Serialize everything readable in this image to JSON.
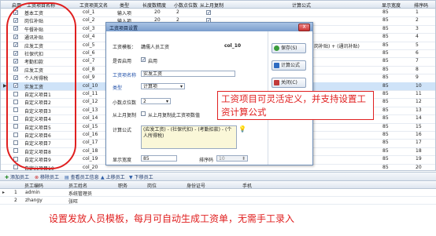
{
  "grid": {
    "headers": [
      "启用",
      "工资项目名称",
      "工资项英文名",
      "类型",
      "长度数精度",
      "小数点位数",
      "从上月复制",
      "计算公式",
      "显示宽度",
      "排序码"
    ],
    "rows": [
      {
        "enabled": "✓",
        "name": "基本工资",
        "en": "col_1",
        "type": "输入项",
        "len": "20",
        "dec": "2",
        "copy": "✓",
        "formula": "",
        "width": "85",
        "order": "1"
      },
      {
        "enabled": "✓",
        "name": "岗位补贴",
        "en": "col_2",
        "type": "输入项",
        "len": "20",
        "dec": "2",
        "copy": "✓",
        "formula": "",
        "width": "85",
        "order": "2"
      },
      {
        "enabled": "✓",
        "name": "午餐补贴",
        "en": "col_3",
        "type": "输入项",
        "len": "",
        "dec": "",
        "copy": "",
        "formula": "",
        "width": "85",
        "order": "3"
      },
      {
        "enabled": "✓",
        "name": "通讯补贴",
        "en": "col_4",
        "type": "",
        "len": "",
        "dec": "",
        "copy": "",
        "formula": "",
        "width": "85",
        "order": "4"
      },
      {
        "enabled": "✓",
        "name": "应发工资",
        "en": "col_5",
        "type": "",
        "len": "",
        "dec": "",
        "copy": "",
        "formula": "岗补贴) + (通讯补贴)",
        "width": "85",
        "order": "5"
      },
      {
        "enabled": "✓",
        "name": "社保代扣",
        "en": "col_6",
        "type": "",
        "len": "",
        "dec": "",
        "copy": "",
        "formula": "",
        "width": "85",
        "order": "6"
      },
      {
        "enabled": "✓",
        "name": "考勤扣款",
        "en": "col_7",
        "type": "",
        "len": "",
        "dec": "",
        "copy": "",
        "formula": "",
        "width": "85",
        "order": "7"
      },
      {
        "enabled": "✓",
        "name": "应发工资",
        "en": "col_8",
        "type": "",
        "len": "",
        "dec": "",
        "copy": "",
        "formula": "",
        "width": "85",
        "order": "8"
      },
      {
        "enabled": "✓",
        "name": "个人所得税",
        "en": "col_9",
        "type": "",
        "len": "",
        "dec": "",
        "copy": "",
        "formula": "",
        "width": "85",
        "order": "9"
      },
      {
        "enabled": "✓",
        "name": "实发工资",
        "en": "col_10",
        "type": "",
        "len": "",
        "dec": "",
        "copy": "",
        "formula": "",
        "width": "85",
        "order": "10",
        "selected": true
      },
      {
        "enabled": "",
        "name": "自定义项目1",
        "en": "col_11",
        "type": "",
        "len": "",
        "dec": "",
        "copy": "",
        "formula": "",
        "width": "85",
        "order": "11"
      },
      {
        "enabled": "",
        "name": "自定义项目2",
        "en": "col_12",
        "type": "",
        "len": "",
        "dec": "",
        "copy": "",
        "formula": "",
        "width": "85",
        "order": "12"
      },
      {
        "enabled": "",
        "name": "自定义项目3",
        "en": "col_13",
        "type": "",
        "len": "",
        "dec": "",
        "copy": "",
        "formula": "",
        "width": "85",
        "order": "13"
      },
      {
        "enabled": "",
        "name": "自定义项目4",
        "en": "col_14",
        "type": "",
        "len": "",
        "dec": "",
        "copy": "",
        "formula": "",
        "width": "85",
        "order": "14"
      },
      {
        "enabled": "",
        "name": "自定义项目5",
        "en": "col_15",
        "type": "",
        "len": "",
        "dec": "",
        "copy": "",
        "formula": "",
        "width": "85",
        "order": "15"
      },
      {
        "enabled": "",
        "name": "自定义项目6",
        "en": "col_16",
        "type": "",
        "len": "",
        "dec": "",
        "copy": "",
        "formula": "",
        "width": "85",
        "order": "16"
      },
      {
        "enabled": "",
        "name": "自定义项目7",
        "en": "col_17",
        "type": "",
        "len": "",
        "dec": "",
        "copy": "",
        "formula": "",
        "width": "85",
        "order": "17"
      },
      {
        "enabled": "",
        "name": "自定义项目8",
        "en": "col_18",
        "type": "",
        "len": "",
        "dec": "",
        "copy": "",
        "formula": "",
        "width": "85",
        "order": "18"
      },
      {
        "enabled": "",
        "name": "自定义项目9",
        "en": "col_19",
        "type": "",
        "len": "",
        "dec": "",
        "copy": "",
        "formula": "",
        "width": "85",
        "order": "19"
      },
      {
        "enabled": "",
        "name": "自定义项目10",
        "en": "col_20",
        "type": "",
        "len": "",
        "dec": "",
        "copy": "",
        "formula": "",
        "width": "85",
        "order": "20"
      }
    ]
  },
  "toolbar": {
    "add": "添加员工",
    "remove": "移除员工",
    "view": "查看员工信息",
    "up": "上移员工",
    "down": "下移员工"
  },
  "sub": {
    "headers": [
      "员工编码",
      "员工姓名",
      "职务",
      "岗位",
      "身份证号",
      "手机"
    ],
    "rows": [
      {
        "no": "1",
        "code": "admin",
        "name": "系统管理员"
      },
      {
        "no": "2",
        "code": "zhangy",
        "name": "张旺"
      }
    ]
  },
  "dialog": {
    "title": "工资项目设置",
    "close": "X",
    "template_label": "工资模板：",
    "template_value": "講儒人员工资",
    "code": "col_10",
    "enabled_label": "是否启用",
    "enabled_check": "启用",
    "name_label": "工资项名称",
    "name_value": "实发工资",
    "type_label": "类型",
    "type_value": "计算项",
    "decimals_label": "小数点位数",
    "decimals_value": "2",
    "copy_label": "从上月复制",
    "copy_check": "从上月复制此工资项数值",
    "formula_label": "计算公式",
    "formula_value": "(应发工资) - (社保代扣) - (考勤扣款) - (个人所得税)",
    "width_label": "显示宽度",
    "width_value": "85",
    "order_label": "排序码",
    "order_value": "10",
    "btn_save": "保存(S)",
    "btn_calc": "计算公式",
    "btn_close": "关闭(C)"
  },
  "annotations": {
    "callout": "工资项目可灵活定义，并支持设置工资计算公式",
    "bottom": "设置发放人员模板，每月可自动生成工资单，无需手工录入"
  },
  "colors": {
    "annotation_red": "#e02020",
    "selection": "#cfe3f8"
  }
}
